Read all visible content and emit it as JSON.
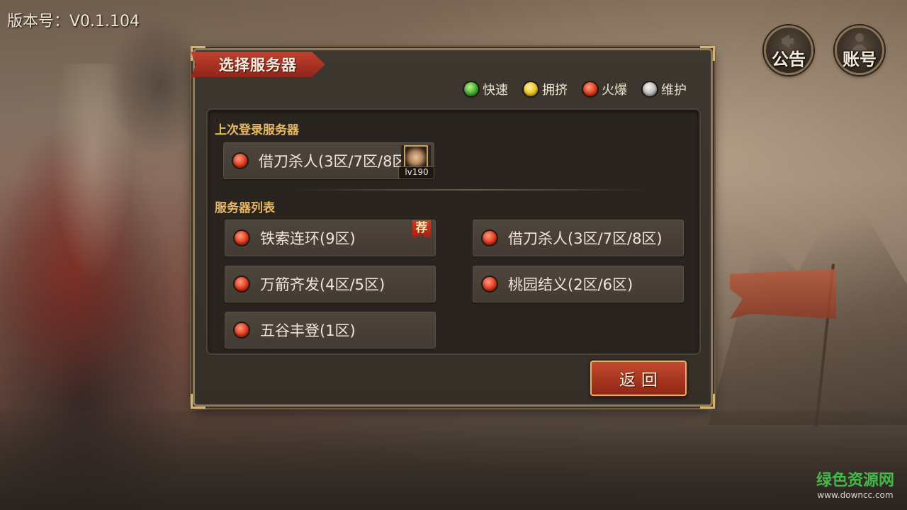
{
  "version": "版本号：V0.1.104",
  "top_buttons": {
    "notice": {
      "label": "公告",
      "icon": "megaphone-icon"
    },
    "account": {
      "label": "账号",
      "icon": "user-icon"
    }
  },
  "panel": {
    "title": "选择服务器",
    "legend": [
      {
        "label": "快速",
        "color": "green"
      },
      {
        "label": "拥挤",
        "color": "yellow"
      },
      {
        "label": "火爆",
        "color": "red"
      },
      {
        "label": "维护",
        "color": "gray"
      }
    ],
    "last_login": {
      "section_title": "上次登录服务器",
      "server": {
        "name": "借刀杀人(3区/7区/8区)",
        "status": "red",
        "level": "lv190"
      }
    },
    "server_list": {
      "section_title": "服务器列表",
      "recommend_tag": "荐",
      "servers": [
        {
          "name": "铁索连环(9区)",
          "status": "red",
          "recommended": true
        },
        {
          "name": "借刀杀人(3区/7区/8区)",
          "status": "red"
        },
        {
          "name": "万箭齐发(4区/5区)",
          "status": "red"
        },
        {
          "name": "桃园结义(2区/6区)",
          "status": "red"
        },
        {
          "name": "五谷丰登(1区)",
          "status": "red"
        }
      ]
    },
    "back_button": "返回"
  },
  "watermark": {
    "text": "绿色资源网",
    "url": "www.downcc.com"
  },
  "colors": {
    "accent_red": "#c4492e",
    "section_title": "#e8b85a",
    "status_green": "#3fae2a",
    "status_yellow": "#f0c11a",
    "status_red": "#e23a1c",
    "status_gray": "#b8b8b8"
  }
}
